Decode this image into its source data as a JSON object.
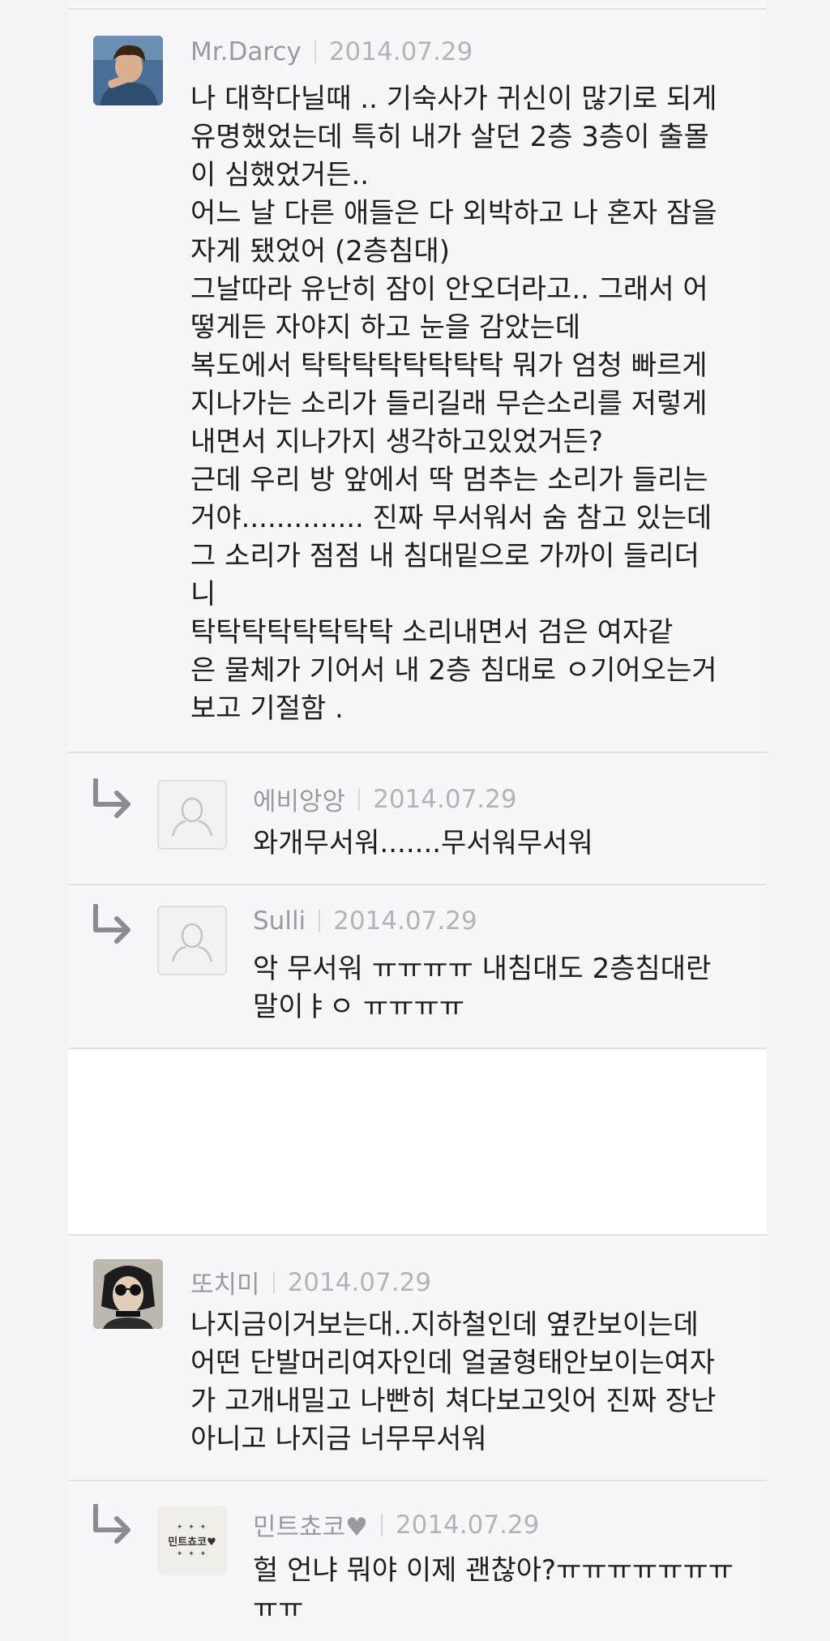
{
  "comments": [
    {
      "author": "Mr.Darcy",
      "date": "2014.07.29",
      "text": "나 대학다닐때 .. 기숙사가 귀신이 많기로 되게\n유명했었는데 특히 내가 살던 2층 3층이 출몰\n이 심했었거든..\n어느 날 다른 애들은 다 외박하고 나 혼자 잠을\n자게 됐었어 (2층침대)\n그날따라 유난히 잠이 안오더라고.. 그래서 어\n떻게든 자야지 하고 눈을 감았는데\n복도에서 탁탁탁탁탁탁탁탁 뭐가 엄청 빠르게\n지나가는 소리가 들리길래 무슨소리를 저렇게\n내면서 지나가지 생각하고있었거든?\n근데 우리 방 앞에서 딱 멈추는 소리가 들리는\n거야.............. 진짜 무서워서 숨 참고 있는데\n그 소리가 점점 내 침대밑으로 가까이 들리더\n니\n탁탁탁탁탁탁탁탁 소리내면서 검은 여자같\n은 물체가 기어서 내 2층 침대로 ㅇ기어오는거\n보고 기절함 ."
    },
    {
      "author": "에비앙앙",
      "date": "2014.07.29",
      "text": "와개무서워.......무서워무서워"
    },
    {
      "author": "Sulli",
      "date": "2014.07.29",
      "text": "악 무서워 ㅠㅠㅠㅠ 내침대도 2층침대란\n말이ㅑㅇ ㅠㅠㅠㅠ"
    },
    {
      "author": "또치미",
      "date": "2014.07.29",
      "text": "나지금이거보는대..지하철인데 옆칸보이는데\n어떤 단발머리여자인데 얼굴형태안보이는여자\n가 고개내밀고 나빤히 쳐다보고잇어 진짜 장난\n아니고 나지금 너무무서워"
    },
    {
      "author": "민트쵸코♥",
      "date": "2014.07.29",
      "text": "헐 언냐 뭐야 이제 괜찮아?ㅠㅠㅠㅠㅠㅠㅠ\nㅠㅠ",
      "logo_text": "민트쵸코♥"
    }
  ],
  "reply_arrow_icon": "reply-arrow-icon",
  "colors": {
    "background": "#f4f4f6",
    "meta_text": "#9a9aa3",
    "body_text": "#1e1e1e",
    "divider": "#e2e2e6"
  }
}
